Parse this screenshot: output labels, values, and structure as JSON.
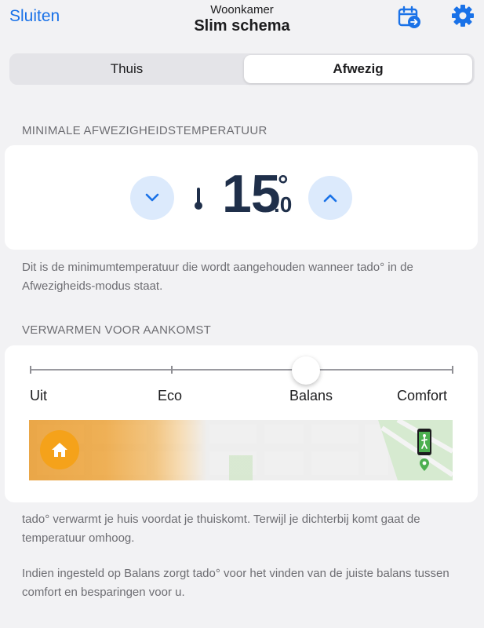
{
  "header": {
    "close_label": "Sluiten",
    "room": "Woonkamer",
    "title": "Slim schema",
    "calendar_icon": "calendar-arrow-icon",
    "settings_icon": "gear-icon"
  },
  "tabs": [
    {
      "label": "Thuis",
      "selected": false
    },
    {
      "label": "Afwezig",
      "selected": true
    }
  ],
  "min_temp": {
    "header": "MINIMALE AFWEZIGHEIDSTEMPERATUUR",
    "value_int": "15",
    "value_dec": ".0",
    "degree": "°",
    "description": "Dit is de minimumtemperatuur die wordt aangehouden wanneer tado° in de Afwezigheids-modus staat."
  },
  "preheat": {
    "header": "VERWARMEN VOOR AANKOMST",
    "stops": [
      "Uit",
      "Eco",
      "Balans",
      "Comfort"
    ],
    "selected_stop": "Balans",
    "description_1": "tado° verwarmt je huis voordat je thuiskomt. Terwijl je dichterbij komt gaat de temperatuur omhoog.",
    "description_2": "Indien ingesteld op Balans zorgt tado° voor het vinden van de juiste balans tussen comfort en besparingen voor u."
  },
  "colors": {
    "accent": "#1a72e8",
    "temp_text": "#1f2f4a",
    "button_bg": "#dceafc",
    "home_orange": "#f5a21a",
    "location_green": "#4caf50"
  }
}
